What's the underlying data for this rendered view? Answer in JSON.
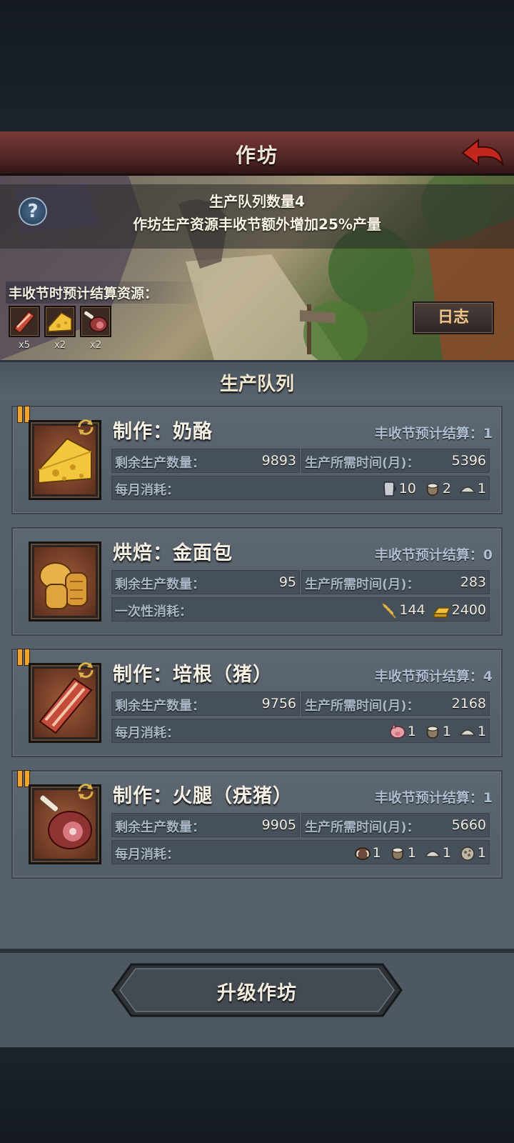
{
  "title": "作坊",
  "banner": {
    "queue_count_text": "生产队列数量4",
    "bonus_text": "作坊生产资源丰收节额外增加25%产量",
    "help_label": "?",
    "settle_label": "丰收节时预计结算资源：",
    "settle_items": [
      {
        "icon": "bacon-icon",
        "count": "x5"
      },
      {
        "icon": "cheese-icon",
        "count": "x2"
      },
      {
        "icon": "ham-icon",
        "count": "x2"
      }
    ],
    "log_button": "日志"
  },
  "queue_header": "生产队列",
  "queue": [
    {
      "title": "制作：奶酪",
      "icon": "cheese-icon",
      "paused": true,
      "settle": "丰收节预计结算：1",
      "remaining_label": "剩余生产数量：",
      "remaining": "9893",
      "time_label": "生产所需时间(月)：",
      "time": "5396",
      "consume_label": "每月消耗：",
      "consumes": [
        {
          "icon": "milk-jug-icon",
          "num": "10"
        },
        {
          "icon": "salt-sack-icon",
          "num": "2"
        },
        {
          "icon": "powder-pile-icon",
          "num": "1"
        }
      ]
    },
    {
      "title": "烘焙：金面包",
      "icon": "bread-icon",
      "paused": false,
      "settle": "丰收节预计结算：0",
      "remaining_label": "剩余生产数量：",
      "remaining": "95",
      "time_label": "生产所需时间(月)：",
      "time": "283",
      "consume_label": "一次性消耗：",
      "consumes": [
        {
          "icon": "wheat-icon",
          "num": "144"
        },
        {
          "icon": "gold-bar-icon",
          "num": "2400"
        }
      ]
    },
    {
      "title": "制作：培根（猪）",
      "icon": "bacon-icon",
      "paused": true,
      "settle": "丰收节预计结算：4",
      "remaining_label": "剩余生产数量：",
      "remaining": "9756",
      "time_label": "生产所需时间(月)：",
      "time": "2168",
      "consume_label": "每月消耗：",
      "consumes": [
        {
          "icon": "pig-icon",
          "num": "1"
        },
        {
          "icon": "salt-sack-icon",
          "num": "1"
        },
        {
          "icon": "powder-pile-icon",
          "num": "1"
        }
      ]
    },
    {
      "title": "制作：火腿（疣猪）",
      "icon": "ham-icon",
      "paused": true,
      "settle": "丰收节预计结算：1",
      "remaining_label": "剩余生产数量：",
      "remaining": "9905",
      "time_label": "生产所需时间(月)：",
      "time": "5660",
      "consume_label": "每月消耗：",
      "consumes": [
        {
          "icon": "warthog-icon",
          "num": "1"
        },
        {
          "icon": "salt-sack-icon",
          "num": "1"
        },
        {
          "icon": "powder-pile-icon",
          "num": "1"
        },
        {
          "icon": "spice-pile-icon",
          "num": "1"
        }
      ]
    }
  ],
  "upgrade_button": "升级作坊",
  "colors": {
    "title_bar": "#4c2322",
    "panel": "#4f5a64",
    "accent_orange": "#f0a52a",
    "label_blue": "#a9b8c7"
  }
}
